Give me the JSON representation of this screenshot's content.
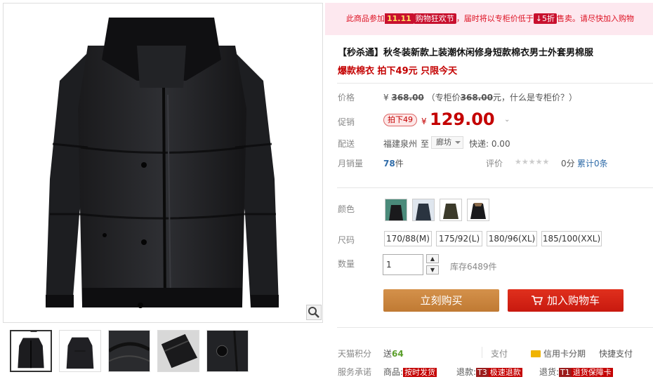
{
  "promo": {
    "prefix": "此商品参加",
    "event_num": "11.11",
    "event_name": "购物狂欢节",
    "middle": "，届时将以专柜价低于",
    "discount": "↓5折",
    "suffix": "售卖。请尽快加入购物"
  },
  "product": {
    "title": "【秒杀通】秋冬装新款上装潮休闲修身短款棉衣男士外套男棉服",
    "subtitle": "爆款棉衣 拍下49元 只限今天"
  },
  "price": {
    "label": "价格",
    "yen": "¥",
    "original": "368.00",
    "note_prefix": "（专柜价",
    "note_value": "368.00",
    "note_suffix": "元，什么是专柜价？）"
  },
  "promotion": {
    "label": "促销",
    "badge": "拍下49",
    "yen": "¥",
    "price": "129.00",
    "chevron": "⌄"
  },
  "shipping": {
    "label": "配送",
    "from": "福建泉州",
    "to_word": "至",
    "city": "廊坊",
    "express": "快递: 0.00"
  },
  "sales": {
    "label": "月销量",
    "count": "78",
    "unit": "件",
    "rating_label": "评价",
    "stars": "★★★★★",
    "score": "0分",
    "reviews": "累计0条"
  },
  "color": {
    "label": "颜色",
    "swatches": [
      "swatch-1",
      "swatch-2",
      "swatch-3",
      "swatch-4"
    ]
  },
  "size": {
    "label": "尺码",
    "options": [
      "170/88(M)",
      "175/92(L)",
      "180/96(XL)",
      "185/100(XXL)"
    ]
  },
  "quantity": {
    "label": "数量",
    "value": "1",
    "up": "▲",
    "down": "▼",
    "stock": "库存6489件"
  },
  "buttons": {
    "buy": "立刻购买",
    "cart": "加入购物车"
  },
  "points": {
    "label": "天猫积分",
    "prefix": "送",
    "value": "64"
  },
  "payment": {
    "label": "支付",
    "credit": "信用卡分期",
    "quick": "快捷支付"
  },
  "service": {
    "label": "服务承诺",
    "goods": "商品:",
    "goods_tag": "按时发货",
    "refund": "退款:",
    "refund_tag1": "T3",
    "refund_tag2": "极速退款",
    "return": "退货:",
    "return_tag1": "T1",
    "return_tag2": "退货保障卡"
  },
  "colors": {
    "price_red": "#c40000",
    "buy_orange": "#c8803a",
    "cart_red": "#d1200f",
    "promo_bg": "#fde8ef"
  }
}
